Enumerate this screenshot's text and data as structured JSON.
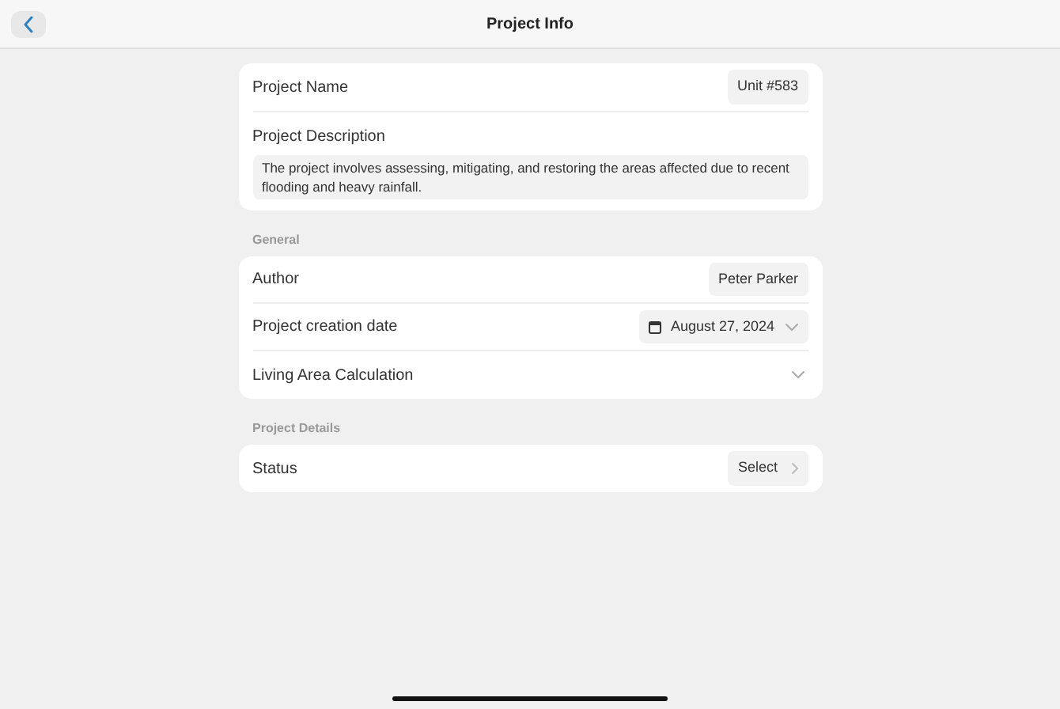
{
  "header": {
    "title": "Project Info"
  },
  "project": {
    "name_label": "Project Name",
    "name_value": "Unit #583",
    "description_label": "Project Description",
    "description": "The project involves assessing, mitigating, and restoring the areas affected due to recent flooding and heavy rainfall."
  },
  "sections": [
    {
      "title": "General",
      "rows": [
        {
          "kind": "value",
          "label": "Author",
          "value": "Peter Parker"
        },
        {
          "kind": "date",
          "label": "Project creation date",
          "value": "August 27, 2024"
        },
        {
          "kind": "expand",
          "label": "Living Area Calculation"
        }
      ]
    },
    {
      "title": "Project Details",
      "rows": [
        {
          "kind": "select",
          "label": "Status",
          "value": "Select"
        }
      ]
    }
  ]
}
